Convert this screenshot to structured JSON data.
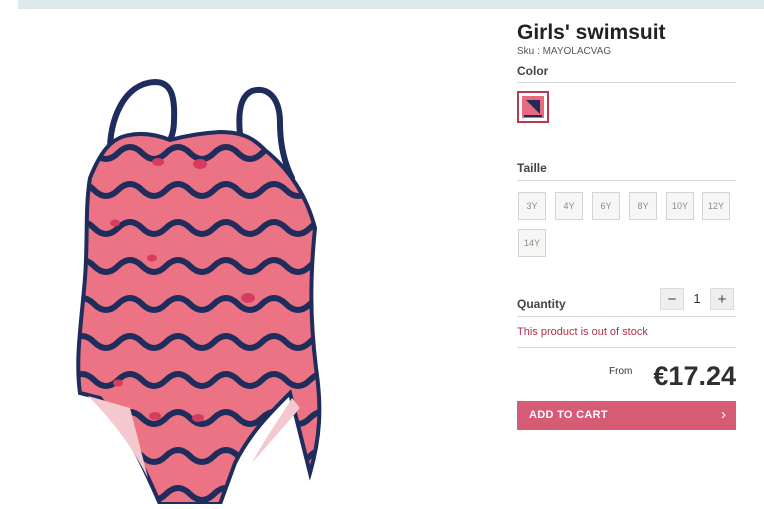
{
  "product": {
    "title": "Girls' swimsuit",
    "sku": "Sku : MAYOLACVAG"
  },
  "color": {
    "label": "Color",
    "swatch_colors": [
      "#e96a7d",
      "#1e2d5c"
    ]
  },
  "size": {
    "label": "Taille",
    "options": [
      "3Y",
      "4Y",
      "6Y",
      "8Y",
      "10Y",
      "12Y",
      "14Y"
    ]
  },
  "quantity": {
    "label": "Quantity",
    "minus": "−",
    "value": "1",
    "plus": "+"
  },
  "stock_message": "This product is out of stock",
  "price": {
    "from_label": "From",
    "value": "€17.24"
  },
  "cart": {
    "label": "ADD TO CART",
    "chevron": "›"
  },
  "colors": {
    "accent": "#d65b74",
    "swimsuit_pink": "#ec7384",
    "swimsuit_navy": "#1e2d5c",
    "topbar": "#dbe8ec"
  }
}
